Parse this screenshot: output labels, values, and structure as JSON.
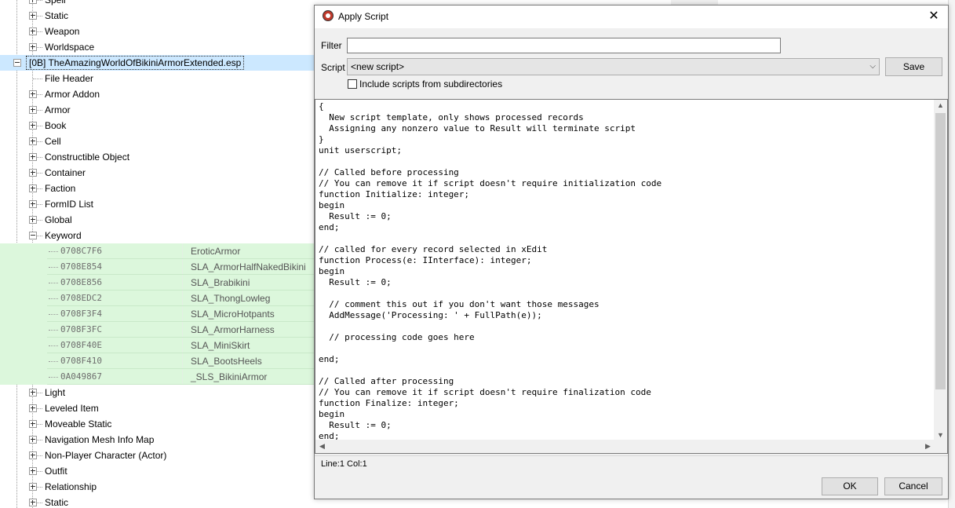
{
  "tree": {
    "top_rows": [
      {
        "label": "Spell",
        "expandable": true
      },
      {
        "label": "Static",
        "expandable": true
      },
      {
        "label": "Weapon",
        "expandable": true
      },
      {
        "label": "Worldspace",
        "expandable": true
      }
    ],
    "plugin": "[0B] TheAmazingWorldOfBikiniArmorExtended.esp",
    "plugin_rows": [
      {
        "label": "File Header",
        "expandable": false
      },
      {
        "label": "Armor Addon",
        "expandable": true
      },
      {
        "label": "Armor",
        "expandable": true
      },
      {
        "label": "Book",
        "expandable": true
      },
      {
        "label": "Cell",
        "expandable": true
      },
      {
        "label": "Constructible Object",
        "expandable": true
      },
      {
        "label": "Container",
        "expandable": true
      },
      {
        "label": "Faction",
        "expandable": true
      },
      {
        "label": "FormID List",
        "expandable": true
      },
      {
        "label": "Global",
        "expandable": true
      },
      {
        "label": "Keyword",
        "expandable": true,
        "expanded": true
      }
    ],
    "keyword_records": [
      {
        "formid": "0708C7F6",
        "editor_id": "EroticArmor"
      },
      {
        "formid": "0708E854",
        "editor_id": "SLA_ArmorHalfNakedBikini"
      },
      {
        "formid": "0708E856",
        "editor_id": "SLA_Brabikini"
      },
      {
        "formid": "0708EDC2",
        "editor_id": "SLA_ThongLowleg"
      },
      {
        "formid": "0708F3F4",
        "editor_id": "SLA_MicroHotpants"
      },
      {
        "formid": "0708F3FC",
        "editor_id": "SLA_ArmorHarness"
      },
      {
        "formid": "0708F40E",
        "editor_id": "SLA_MiniSkirt"
      },
      {
        "formid": "0708F410",
        "editor_id": "SLA_BootsHeels"
      },
      {
        "formid": "0A049867",
        "editor_id": "_SLS_BikiniArmor"
      }
    ],
    "after_rows": [
      {
        "label": "Light",
        "expandable": true
      },
      {
        "label": "Leveled Item",
        "expandable": true
      },
      {
        "label": "Moveable Static",
        "expandable": true
      },
      {
        "label": "Navigation Mesh Info Map",
        "expandable": true
      },
      {
        "label": "Non-Player Character (Actor)",
        "expandable": true
      },
      {
        "label": "Outfit",
        "expandable": true
      },
      {
        "label": "Relationship",
        "expandable": true
      },
      {
        "label": "Static",
        "expandable": true
      }
    ]
  },
  "dialog": {
    "title": "Apply Script",
    "close_glyph": "✕",
    "filter_label": "Filter",
    "filter_value": "",
    "script_label": "Script",
    "script_value": "<new script>",
    "save_label": "Save",
    "subdir_checked": false,
    "subdir_label": "Include scripts from subdirectories",
    "code": "{\n  New script template, only shows processed records\n  Assigning any nonzero value to Result will terminate script\n}\nunit userscript;\n\n// Called before processing\n// You can remove it if script doesn't require initialization code\nfunction Initialize: integer;\nbegin\n  Result := 0;\nend;\n\n// called for every record selected in xEdit\nfunction Process(e: IInterface): integer;\nbegin\n  Result := 0;\n\n  // comment this out if you don't want those messages\n  AddMessage('Processing: ' + FullPath(e));\n\n  // processing code goes here\n\nend;\n\n// Called after processing\n// You can remove it if script doesn't require finalization code\nfunction Finalize: integer;\nbegin\n  Result := 0;\nend;",
    "status": "Line:1 Col:1",
    "ok_label": "OK",
    "cancel_label": "Cancel"
  },
  "colors": {
    "selected_row": "#cce8ff",
    "record_row": "#dcf7dc",
    "dialog_bg": "#f0f0f0"
  }
}
